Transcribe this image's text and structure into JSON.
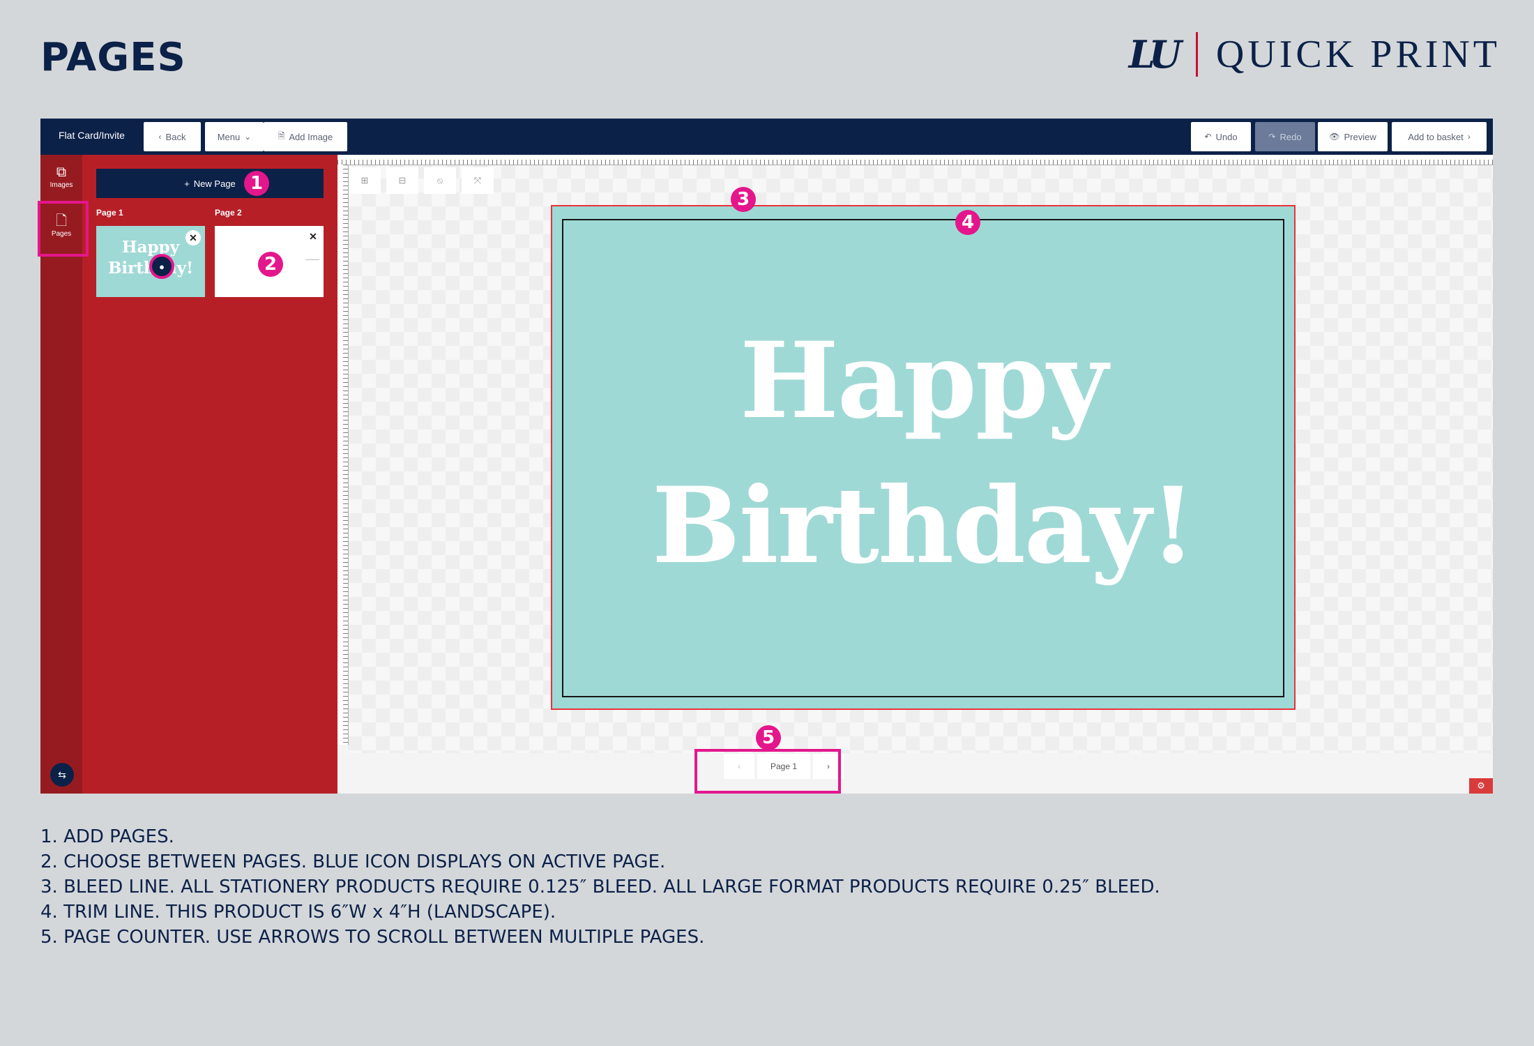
{
  "header": {
    "page_title": "PAGES",
    "brand_mark": "LU",
    "brand_name": "QUICK PRINT"
  },
  "colors": {
    "navy": "#0c2148",
    "red": "#b71f26",
    "dark_red": "#961b20",
    "card_teal": "#9fd9d5",
    "bleed_line": "#e8333b",
    "callout_pink": "#e4168c"
  },
  "toolbar": {
    "product_title": "Flat Card/Invite",
    "back_label": "Back",
    "menu_label": "Menu",
    "add_image_label": "Add Image",
    "undo_label": "Undo",
    "redo_label": "Redo",
    "preview_label": "Preview",
    "basket_label": "Add to basket"
  },
  "rail": {
    "items": [
      {
        "label": "Images",
        "icon": "images-icon"
      },
      {
        "label": "Pages",
        "icon": "page-icon",
        "active": true
      }
    ]
  },
  "panel": {
    "new_page_label": "New Page",
    "pages": [
      {
        "label": "Page 1",
        "thumb_text": "Happy Birthday!",
        "active": true
      },
      {
        "label": "Page 2",
        "thumb_text": "",
        "active": false
      }
    ]
  },
  "canvas": {
    "card_text_line1": "Happy",
    "card_text_line2": "Birthday!",
    "pager_label": "Page 1"
  },
  "callouts": [
    "1",
    "2",
    "3",
    "4",
    "5"
  ],
  "notes": [
    "1. ADD PAGES.",
    "2. CHOOSE BETWEEN PAGES. BLUE ICON DISPLAYS ON ACTIVE PAGE.",
    "3. BLEED LINE. ALL STATIONERY PRODUCTS REQUIRE 0.125″ BLEED. ALL LARGE FORMAT PRODUCTS REQUIRE 0.25″ BLEED.",
    "4. TRIM LINE. THIS PRODUCT IS 6″W x 4″H (LANDSCAPE).",
    "5. PAGE COUNTER. USE ARROWS TO SCROLL BETWEEN MULTIPLE PAGES."
  ]
}
